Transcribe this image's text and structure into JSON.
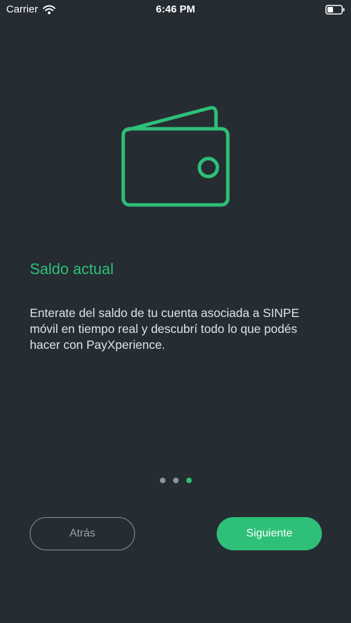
{
  "status_bar": {
    "carrier": "Carrier",
    "time": "6:46 PM"
  },
  "onboarding": {
    "illustration_icon": "wallet-icon",
    "title": "Saldo actual",
    "description": "Enterate del saldo de tu cuenta asociada a SINPE móvil en tiempo real y descubrí todo lo que podés hacer con PayXperience.",
    "page_indicator": {
      "total": 3,
      "current": 3
    }
  },
  "buttons": {
    "back_label": "Atrás",
    "next_label": "Siguiente"
  },
  "colors": {
    "background": "#252c32",
    "accent": "#2ebf78",
    "muted": "#8f9599"
  }
}
